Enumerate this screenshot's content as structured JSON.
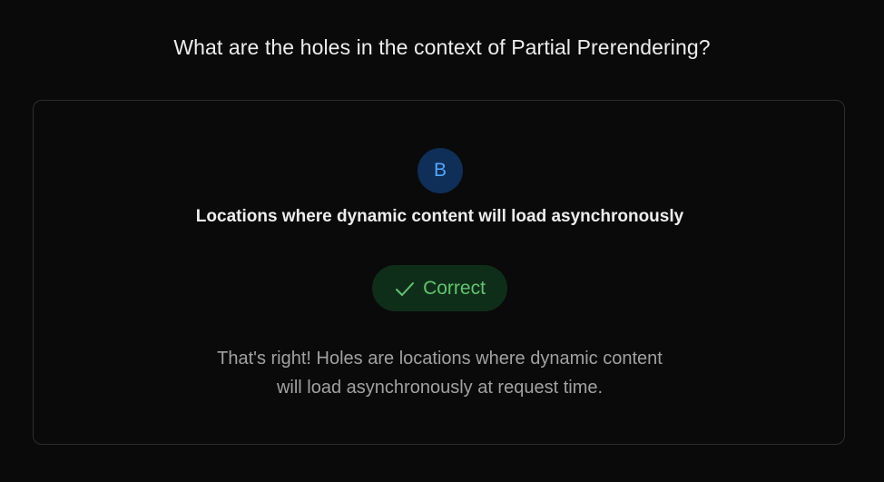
{
  "question": "What are the holes in the context of Partial Prerendering?",
  "answer": {
    "option_letter": "B",
    "text": "Locations where dynamic content will load asynchronously"
  },
  "result": {
    "icon": "check-icon",
    "label": "Correct",
    "color": "#61c46f"
  },
  "explanation": {
    "line1": "That's right! Holes are locations where dynamic content",
    "line2": "will load asynchronously at request time."
  },
  "colors": {
    "background": "#0a0a0a",
    "option_badge_bg": "#0f2e58",
    "option_badge_text": "#52a8ff",
    "correct_bg": "#0f2e1a"
  }
}
